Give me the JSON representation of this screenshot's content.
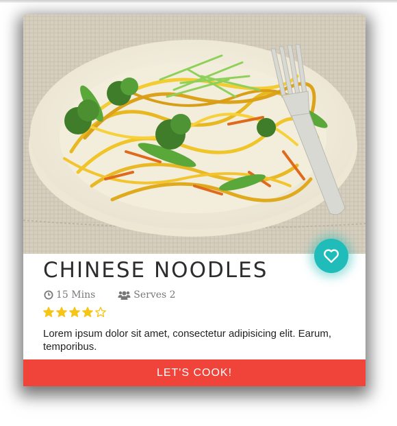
{
  "recipe": {
    "title": "CHINESE NOODLES",
    "time": "15 Mins",
    "serves": "Serves 2",
    "rating": 4,
    "rating_max": 5,
    "description": "Lorem ipsum dolor sit amet, consectetur adipisicing elit. Earum, temporibus.",
    "cta_label": "LET'S COOK!"
  },
  "icons": {
    "time": "clock-icon",
    "serves": "users-icon",
    "favorite": "heart-icon",
    "star": "star-icon"
  },
  "colors": {
    "accent": "#1fbcb9",
    "cta": "#f0433a",
    "star": "#f5c518"
  }
}
